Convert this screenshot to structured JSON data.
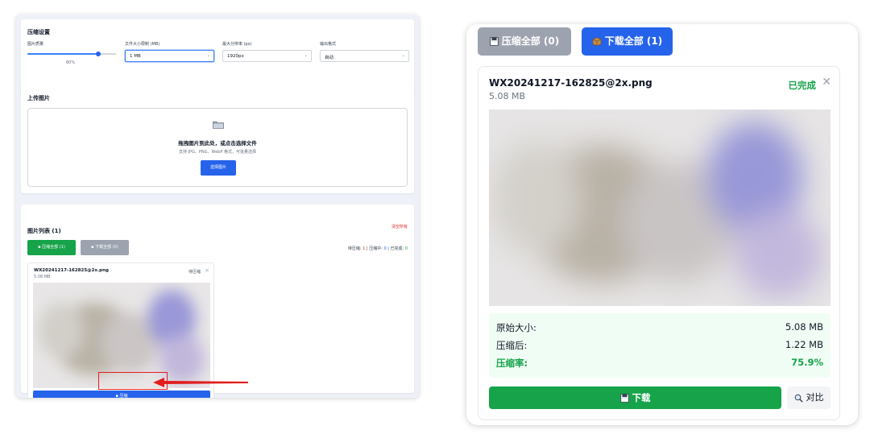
{
  "left": {
    "settings": {
      "title": "压缩设置",
      "quality_label": "图片质量",
      "quality_value": "80%",
      "quality_fraction": 0.8,
      "max_size_label": "文件大小限制 (MB)",
      "max_size_value": "1 MB",
      "max_res_label": "最大分辨率 (px)",
      "max_res_value": "1920px",
      "format_label": "输出格式",
      "format_value": "自动"
    },
    "upload": {
      "title": "上传图片",
      "drop_title": "拖拽图片到此处，或点击选择文件",
      "drop_sub": "支持 JPG、PNG、WebP 格式，可批量选择",
      "select_button": "选择图片"
    },
    "list": {
      "title": "图片列表 (1)",
      "clear_all": "清空所有",
      "compress_all": "压缩全部 (1)",
      "download_all": "下载全部 (0)",
      "stats": {
        "waiting_label": "待压缩:",
        "waiting_value": "1",
        "processing_label": "压缩中:",
        "processing_value": "0",
        "done_label": "已完成:",
        "done_value": "0"
      },
      "item": {
        "name": "WX20241217-162825@2x.png",
        "size": "5.08 MB",
        "status": "待压缩",
        "compress_button": "压缩"
      }
    }
  },
  "right": {
    "compress_all": "压缩全部 (0)",
    "download_all": "下载全部 (1)",
    "item": {
      "name": "WX20241217-162825@2x.png",
      "size": "5.08 MB",
      "status": "已完成",
      "stats": {
        "original_label": "原始大小:",
        "original_value": "5.08 MB",
        "compressed_label": "压缩后:",
        "compressed_value": "1.22 MB",
        "ratio_label": "压缩率:",
        "ratio_value": "75.9%"
      },
      "download_button": "下载",
      "compare_button": "对比"
    }
  },
  "colors": {
    "primary": "#2563eb",
    "success": "#16a34a",
    "danger": "#dc2626",
    "muted": "#9ca3af"
  }
}
